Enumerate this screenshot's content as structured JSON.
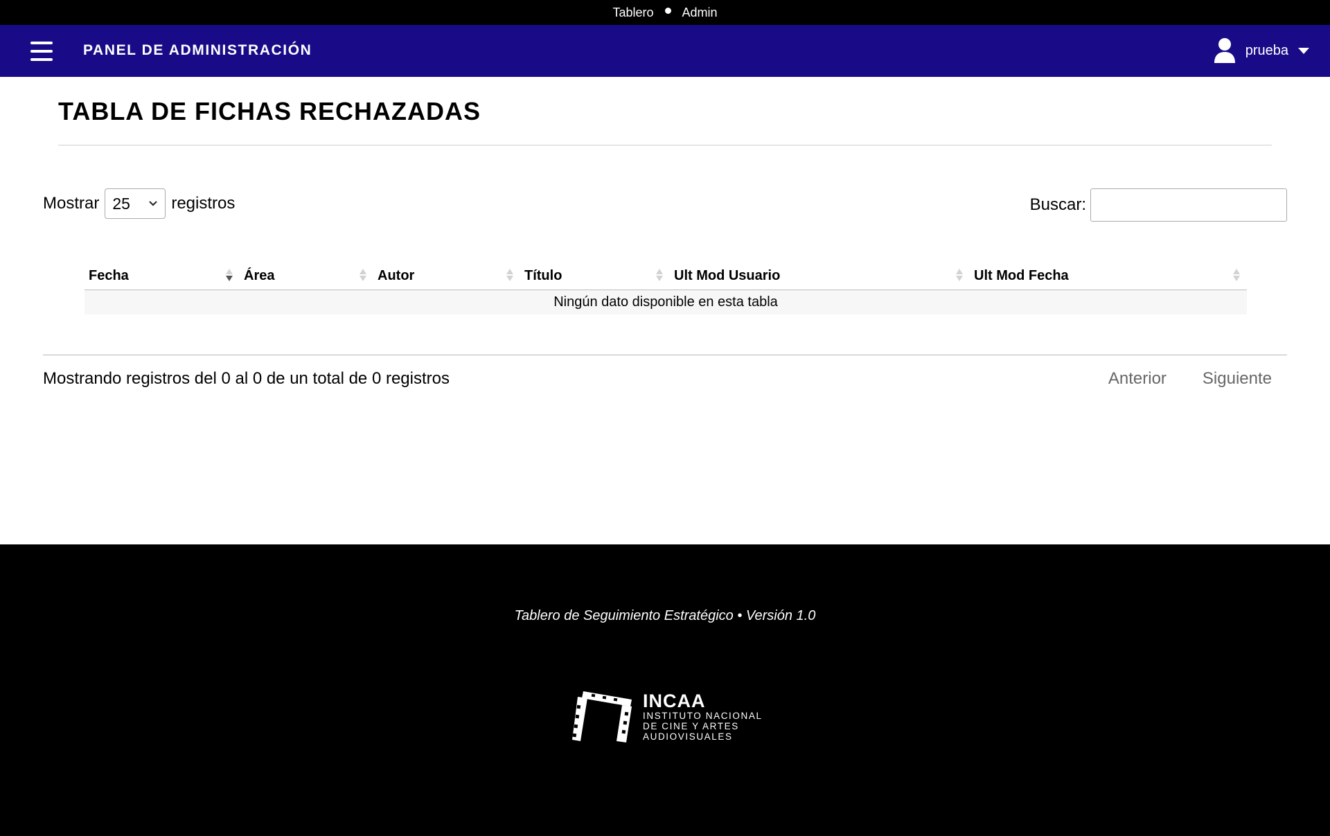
{
  "breadcrumb": {
    "items": [
      "Tablero",
      "Admin"
    ]
  },
  "header": {
    "title": "PANEL DE ADMINISTRACIÓN",
    "user_name": "prueba",
    "brand_color": "#190b87"
  },
  "page": {
    "title": "TABLA DE FICHAS RECHAZADAS"
  },
  "length_control": {
    "prefix": "Mostrar",
    "selected": "25",
    "suffix": "registros"
  },
  "search": {
    "label": "Buscar:",
    "value": ""
  },
  "table": {
    "columns": [
      "Fecha",
      "Área",
      "Autor",
      "Título",
      "Ult Mod Usuario",
      "Ult Mod Fecha"
    ],
    "sorted_column": "Fecha",
    "empty_message": "Ningún dato disponible en esta tabla"
  },
  "info": "Mostrando registros del 0 al 0 de un total de 0 registros",
  "pagination": {
    "previous": "Anterior",
    "next": "Siguiente"
  },
  "footer": {
    "text": "Tablero de Seguimiento Estratégico • Versión 1.0",
    "logo": {
      "name": "INCAA",
      "line1": "INSTITUTO NACIONAL",
      "line2": "DE CINE Y ARTES",
      "line3": "AUDIOVISUALES"
    }
  }
}
